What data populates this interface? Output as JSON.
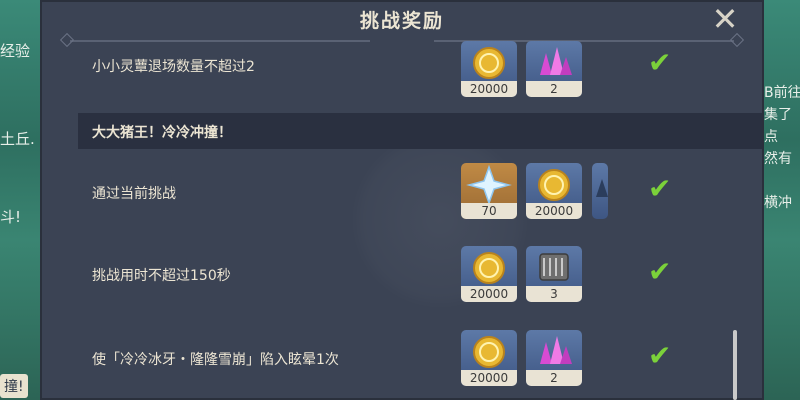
{
  "dialog": {
    "title": "挑战奖励",
    "close_icon": "close-icon"
  },
  "background": {
    "left_texts": [
      "经验",
      "土丘.",
      "斗!",
      "撞!"
    ],
    "right_texts": [
      "B前往",
      "集了",
      "点",
      "然有",
      "横冲"
    ]
  },
  "rows": [
    {
      "label": "小小灵蕈退场数量不超过2",
      "rewards": [
        {
          "icon": "mora-coin-icon",
          "count": "20000"
        },
        {
          "icon": "crystal-chunk-icon",
          "count": "2"
        }
      ],
      "completed": true
    },
    {
      "section_header": "大大猪王！冷冷冲撞！"
    },
    {
      "label": "通过当前挑战",
      "rewards": [
        {
          "icon": "primogem-icon",
          "count": "70"
        },
        {
          "icon": "mora-coin-icon",
          "count": "20000"
        },
        {
          "icon": "partial-item-icon",
          "count": ""
        }
      ],
      "completed": true
    },
    {
      "label": "挑战用时不超过150秒",
      "rewards": [
        {
          "icon": "mora-coin-icon",
          "count": "20000"
        },
        {
          "icon": "scroll-item-icon",
          "count": "3"
        }
      ],
      "completed": true
    },
    {
      "label": "使「冷冷冰牙・隆隆雪崩」陷入眩晕1次",
      "rewards": [
        {
          "icon": "mora-coin-icon",
          "count": "20000"
        },
        {
          "icon": "crystal-chunk-icon",
          "count": "2"
        }
      ],
      "completed": true
    }
  ],
  "colors": {
    "panel": "#3b4354",
    "section": "#2a3040",
    "check": "#7bd13a",
    "text": "#ece5d3"
  }
}
